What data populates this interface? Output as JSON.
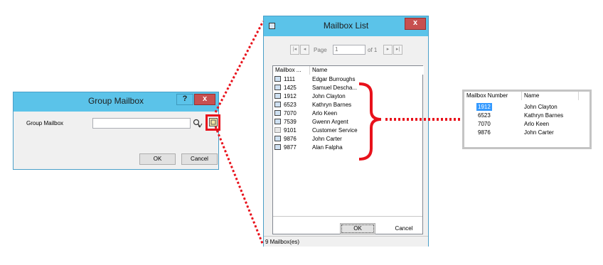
{
  "group_dialog": {
    "title": "Group Mailbox",
    "help_label": "?",
    "close_label": "x",
    "field_label": "Group Mailbox",
    "field_value": "",
    "ok_label": "OK",
    "cancel_label": "Cancel"
  },
  "mailbox_list_dialog": {
    "title": "Mailbox List",
    "close_label": "x",
    "pager": {
      "first": "|◂",
      "prev": "◂",
      "page_label": "Page",
      "page_value": "1",
      "of_label": "of 1",
      "next": "▸",
      "last": "▸|"
    },
    "columns": [
      "Mailbox ...",
      "Name"
    ],
    "rows": [
      {
        "mailbox": "1111",
        "name": "Edgar Burroughs"
      },
      {
        "mailbox": "1425",
        "name": "Samuel Descha..."
      },
      {
        "mailbox": "1912",
        "name": "John Clayton"
      },
      {
        "mailbox": "6523",
        "name": "Kathryn Barnes"
      },
      {
        "mailbox": "7070",
        "name": "Arlo Keen"
      },
      {
        "mailbox": "7539",
        "name": "Gwenn Argent"
      },
      {
        "mailbox": "9101",
        "name": "Customer Service"
      },
      {
        "mailbox": "9876",
        "name": "John Carter"
      },
      {
        "mailbox": "9877",
        "name": "Alan Falpha"
      }
    ],
    "ok_label": "OK",
    "cancel_label": "Cancel",
    "status": "9 Mailbox(es)"
  },
  "group_members_panel": {
    "columns": [
      "Mailbox Number",
      "Name"
    ],
    "rows": [
      {
        "mailbox": "1912",
        "name": "John Clayton"
      },
      {
        "mailbox": "6523",
        "name": "Kathryn Barnes"
      },
      {
        "mailbox": "7070",
        "name": "Arlo Keen"
      },
      {
        "mailbox": "9876",
        "name": "John Carter"
      }
    ]
  },
  "colors": {
    "titlebar": "#5bc3e9",
    "close_button": "#c75050",
    "callout": "#e8111b",
    "selection": "#3399ff"
  }
}
